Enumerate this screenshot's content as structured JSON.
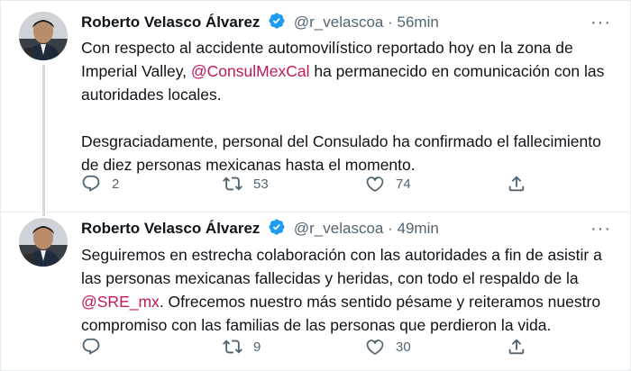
{
  "tweets": [
    {
      "author_name": "Roberto Velasco Álvarez",
      "handle": "@r_velascoa",
      "separator": "·",
      "time": "56min",
      "body": {
        "p1_a": "Con respecto al accidente automovilístico reportado hoy en la zona de Imperial Valley, ",
        "p1_mention": "@ConsulMexCal",
        "p1_b": " ha permanecido en comunicación con las autoridades locales.",
        "p2": "Desgraciadamente, personal del Consulado ha confirmado el fallecimiento de diez personas mexicanas hasta el momento."
      },
      "counts": {
        "reply": "2",
        "retweet": "53",
        "like": "74"
      }
    },
    {
      "author_name": "Roberto Velasco Álvarez",
      "handle": "@r_velascoa",
      "separator": "·",
      "time": "49min",
      "body": {
        "p1_a": "Seguiremos en estrecha colaboración con las autoridades a fin de asistir a las personas mexicanas fallecidas y heridas, con todo el respaldo de la ",
        "p1_mention": "@SRE_mx",
        "p1_b": ". Ofrecemos nuestro más sentido pésame y reiteramos nuestro compromiso con las familias de las personas que perdieron la vida."
      },
      "counts": {
        "reply": "",
        "retweet": "9",
        "like": "30"
      }
    }
  ],
  "more_menu": "···",
  "colors": {
    "mention": "#c2185b",
    "verified": "#1d9bf0",
    "muted": "#536471",
    "text": "#0f1419"
  },
  "icons": [
    "verified-badge-icon",
    "reply-icon",
    "retweet-icon",
    "like-icon",
    "share-icon",
    "more-icon"
  ]
}
